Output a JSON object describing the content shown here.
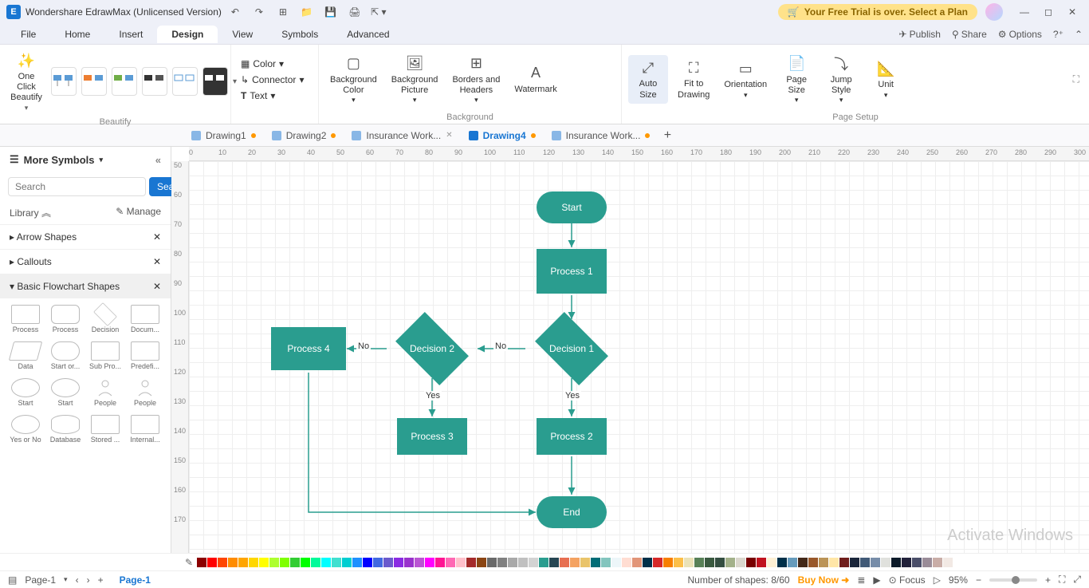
{
  "title": "Wondershare EdrawMax (Unlicensed Version)",
  "trial_text": "Your Free Trial is over. Select a Plan",
  "menu": [
    "File",
    "Home",
    "Insert",
    "Design",
    "View",
    "Symbols",
    "Advanced"
  ],
  "menu_active": "Design",
  "menu_right": {
    "publish": "Publish",
    "share": "Share",
    "options": "Options"
  },
  "ribbon": {
    "beautify_btn": "One Click\nBeautify",
    "group_beautify": "Beautify",
    "color": "Color",
    "connector": "Connector",
    "text": "Text",
    "bg_color": "Background\nColor",
    "bg_pic": "Background\nPicture",
    "borders": "Borders and\nHeaders",
    "watermark": "Watermark",
    "group_bg": "Background",
    "auto_size": "Auto\nSize",
    "fit": "Fit to\nDrawing",
    "orientation": "Orientation",
    "page_size": "Page\nSize",
    "jump_style": "Jump\nStyle",
    "unit": "Unit",
    "group_page": "Page Setup"
  },
  "tabs": [
    {
      "label": "Drawing1",
      "dirty": true,
      "active": false
    },
    {
      "label": "Drawing2",
      "dirty": true,
      "active": false
    },
    {
      "label": "Insurance Work...",
      "dirty": false,
      "active": false,
      "close": true
    },
    {
      "label": "Drawing4",
      "dirty": true,
      "active": true
    },
    {
      "label": "Insurance Work...",
      "dirty": true,
      "active": false
    }
  ],
  "sidebar": {
    "more": "More Symbols",
    "search_placeholder": "Search",
    "search_btn": "Search",
    "library": "Library",
    "manage": "Manage",
    "cats": [
      "Arrow Shapes",
      "Callouts",
      "Basic Flowchart Shapes"
    ],
    "shapes": [
      "Process",
      "Process",
      "Decision",
      "Docum...",
      "Data",
      "Start or...",
      "Sub Pro...",
      "Predefi...",
      "Start",
      "Start",
      "People",
      "People",
      "Yes or No",
      "Database",
      "Stored ...",
      "Internal..."
    ]
  },
  "flow": {
    "start": "Start",
    "p1": "Process 1",
    "d1": "Decision 1",
    "d2": "Decision 2",
    "p2": "Process 2",
    "p3": "Process 3",
    "p4": "Process 4",
    "end": "End",
    "yes": "Yes",
    "no": "No"
  },
  "ruler_h": [
    0,
    10,
    20,
    30,
    40,
    50,
    60,
    70,
    80,
    90,
    100,
    110,
    120,
    130,
    140,
    150,
    160,
    170,
    180,
    190,
    200,
    210,
    220,
    230,
    240,
    250,
    260,
    270,
    280,
    290,
    300
  ],
  "ruler_v": [
    50,
    60,
    70,
    80,
    90,
    100,
    110,
    120,
    130,
    140,
    150,
    160,
    170
  ],
  "status": {
    "page": "Page-1",
    "pagetab": "Page-1",
    "shapes": "Number of shapes: 8/60",
    "buy": "Buy Now",
    "focus": "Focus",
    "zoom": "95%"
  },
  "watermark_os": "Activate Windows",
  "colors": [
    "#8b0000",
    "#ff0000",
    "#ff4500",
    "#ff8c00",
    "#ffa500",
    "#ffd700",
    "#ffff00",
    "#adff2f",
    "#7fff00",
    "#32cd32",
    "#00ff00",
    "#00fa9a",
    "#00ffff",
    "#40e0d0",
    "#00ced1",
    "#1e90ff",
    "#0000ff",
    "#4169e1",
    "#6a5acd",
    "#8a2be2",
    "#9932cc",
    "#ba55d3",
    "#ff00ff",
    "#ff1493",
    "#ff69b4",
    "#ffc0cb",
    "#a52a2a",
    "#8b4513",
    "#696969",
    "#808080",
    "#a9a9a9",
    "#c0c0c0",
    "#d3d3d3",
    "#2a9d8f",
    "#264653",
    "#e76f51",
    "#f4a261",
    "#e9c46a",
    "#006d77",
    "#83c5be",
    "#edf6f9",
    "#ffddd2",
    "#e29578",
    "#003049",
    "#d62828",
    "#f77f00",
    "#fcbf49",
    "#eae2b7",
    "#588157",
    "#3a5a40",
    "#344e41",
    "#a3b18a",
    "#dad7cd",
    "#780000",
    "#c1121f",
    "#fdf0d5",
    "#003049",
    "#669bbc",
    "#432818",
    "#99582a",
    "#bb9457",
    "#ffe6a7",
    "#6f1d1b",
    "#1b263b",
    "#415a77",
    "#778da9",
    "#e0e1dd",
    "#0d1b2a",
    "#22223b",
    "#4a4e69",
    "#9a8c98",
    "#c9ada7",
    "#f2e9e4"
  ]
}
